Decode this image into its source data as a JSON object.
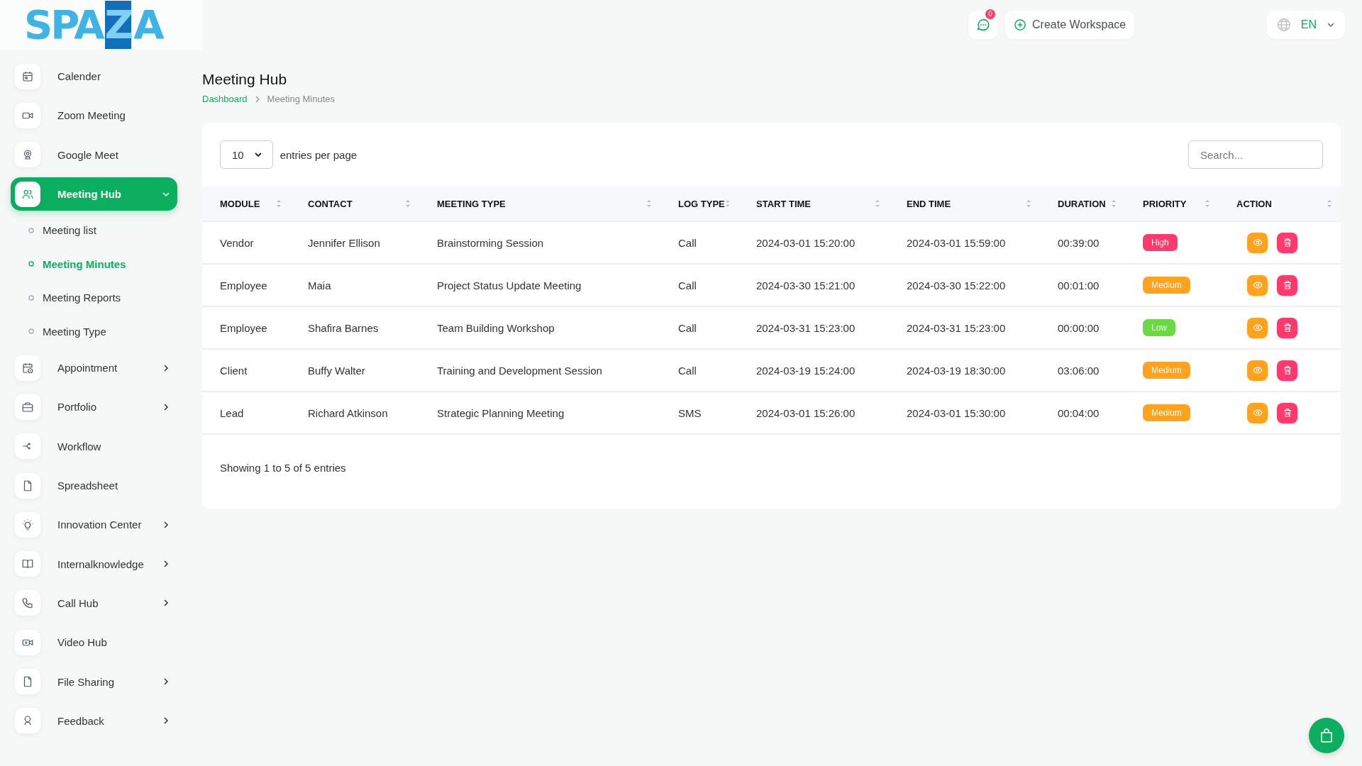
{
  "header": {
    "logo": "SPAZA",
    "notification_count": "0",
    "create_button": "Create Workspace",
    "language": "EN"
  },
  "sidebar": {
    "items": [
      {
        "label": "Calender",
        "expandable": false,
        "expanded": false,
        "selected": false
      },
      {
        "label": "Zoom Meeting",
        "expandable": false,
        "expanded": false,
        "selected": false
      },
      {
        "label": "Google Meet",
        "expandable": false,
        "expanded": false,
        "selected": false
      },
      {
        "label": "Meeting Hub",
        "expandable": true,
        "expanded": true,
        "selected": true,
        "children": [
          {
            "label": "Meeting list",
            "selected": false
          },
          {
            "label": "Meeting Minutes",
            "selected": true
          },
          {
            "label": "Meeting Reports",
            "selected": false
          },
          {
            "label": "Meeting Type",
            "selected": false
          }
        ]
      },
      {
        "label": "Appointment",
        "expandable": true,
        "expanded": false,
        "selected": false
      },
      {
        "label": "Portfolio",
        "expandable": true,
        "expanded": false,
        "selected": false
      },
      {
        "label": "Workflow",
        "expandable": false,
        "expanded": false,
        "selected": false
      },
      {
        "label": "Spreadsheet",
        "expandable": false,
        "expanded": false,
        "selected": false
      },
      {
        "label": "Innovation Center",
        "expandable": true,
        "expanded": false,
        "selected": false
      },
      {
        "label": "Internalknowledge",
        "expandable": true,
        "expanded": false,
        "selected": false
      },
      {
        "label": "Call Hub",
        "expandable": true,
        "expanded": false,
        "selected": false
      },
      {
        "label": "Video Hub",
        "expandable": false,
        "expanded": false,
        "selected": false
      },
      {
        "label": "File Sharing",
        "expandable": true,
        "expanded": false,
        "selected": false
      },
      {
        "label": "Feedback",
        "expandable": true,
        "expanded": false,
        "selected": false
      }
    ]
  },
  "page": {
    "title": "Meeting Hub",
    "breadcrumb": [
      "Dashboard",
      "Meeting Minutes"
    ]
  },
  "table": {
    "per_page": "10",
    "per_page_label": "entries per page",
    "search": {
      "placeholder": "Search..."
    },
    "columns": [
      "MODULE",
      "CONTACT",
      "MEETING TYPE",
      "LOG TYPE",
      "START TIME",
      "END TIME",
      "DURATION",
      "PRIORITY",
      "ACTION"
    ],
    "rows": [
      {
        "module": "Vendor",
        "contact": "Jennifer Ellison",
        "meeting_type": "Brainstorming Session",
        "log_type": "Call",
        "start_time": "2024-03-01 15:20:00",
        "end_time": "2024-03-01 15:59:00",
        "duration": "00:39:00",
        "priority": {
          "label": "High",
          "color": "#fd3a6b"
        }
      },
      {
        "module": "Employee",
        "contact": "Maia",
        "meeting_type": "Project Status Update Meeting",
        "log_type": "Call",
        "start_time": "2024-03-30 15:21:00",
        "end_time": "2024-03-30 15:22:00",
        "duration": "00:01:00",
        "priority": {
          "label": "Medium",
          "color": "#ffa21d"
        }
      },
      {
        "module": "Employee",
        "contact": "Shafira Barnes",
        "meeting_type": "Team Building Workshop",
        "log_type": "Call",
        "start_time": "2024-03-31 15:23:00",
        "end_time": "2024-03-31 15:23:00",
        "duration": "00:00:00",
        "priority": {
          "label": "Low",
          "color": "#6ad944"
        }
      },
      {
        "module": "Client",
        "contact": "Buffy Walter",
        "meeting_type": "Training and Development Session",
        "log_type": "Call",
        "start_time": "2024-03-19 15:24:00",
        "end_time": "2024-03-19 18:30:00",
        "duration": "03:06:00",
        "priority": {
          "label": "Medium",
          "color": "#ffa21d"
        }
      },
      {
        "module": "Lead",
        "contact": "Richard Atkinson",
        "meeting_type": "Strategic Planning Meeting",
        "log_type": "SMS",
        "start_time": "2024-03-01 15:26:00",
        "end_time": "2024-03-01 15:30:00",
        "duration": "00:04:00",
        "priority": {
          "label": "Medium",
          "color": "#ffa21d"
        }
      }
    ],
    "footer": "Showing 1 to 5 of 5 entries"
  }
}
